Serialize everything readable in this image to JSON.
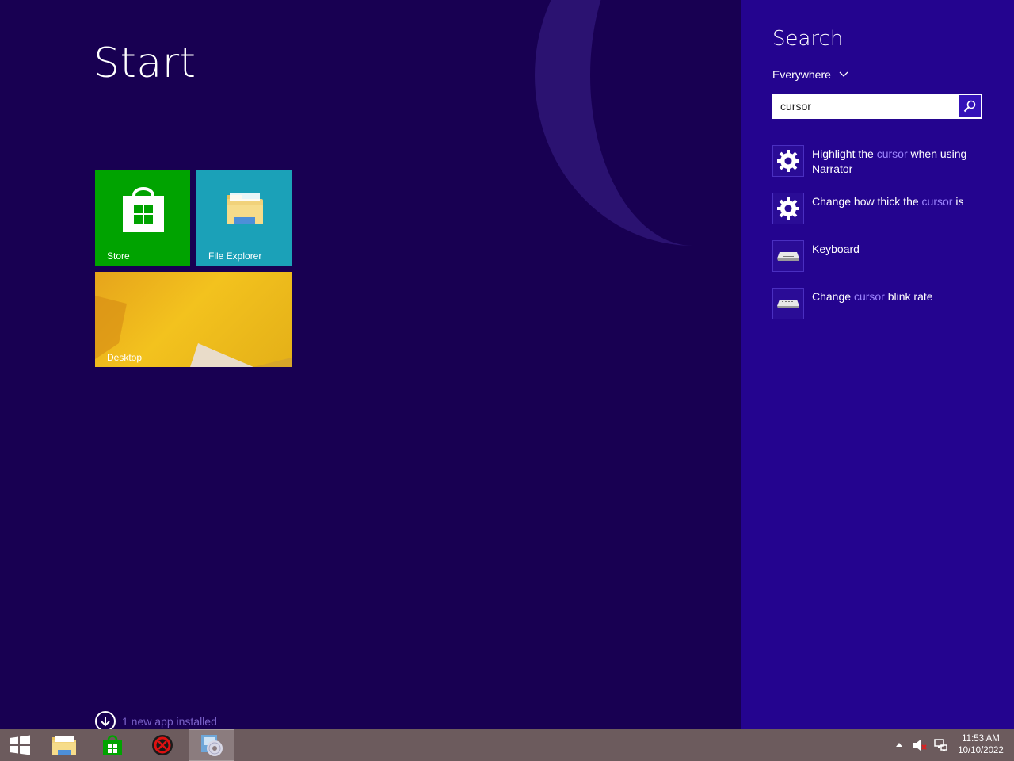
{
  "start": {
    "title": "Start",
    "tiles": [
      {
        "label": "Store",
        "icon": "store-bag-icon",
        "color": "#00a300"
      },
      {
        "label": "File Explorer",
        "icon": "folder-icon",
        "color": "#1ba1b8"
      },
      {
        "label": "Desktop",
        "icon": "desktop-wallpaper",
        "color": "#f3c21e"
      }
    ],
    "notification": "1 new app installed",
    "background": "#180052"
  },
  "search": {
    "title": "Search",
    "scope": "Everywhere",
    "query": "cursor",
    "results": [
      {
        "icon": "gear-icon",
        "before": "Highlight the ",
        "match": "cursor",
        "after": " when using Narrator"
      },
      {
        "icon": "gear-icon",
        "before": "Change how thick the ",
        "match": "cursor",
        "after": " is"
      },
      {
        "icon": "keyboard-icon",
        "before": "Keyboard",
        "match": "",
        "after": ""
      },
      {
        "icon": "keyboard-icon",
        "before": "Change ",
        "match": "cursor",
        "after": " blink rate"
      }
    ],
    "pane_color": "#24048f",
    "highlight_color": "#9d86ff"
  },
  "taskbar": {
    "buttons": [
      "windows-start-icon",
      "file-explorer-icon",
      "store-icon",
      "security-app-icon",
      "disc-installer-icon"
    ],
    "clock": {
      "time": "11:53 AM",
      "date": "10/10/2022"
    }
  }
}
